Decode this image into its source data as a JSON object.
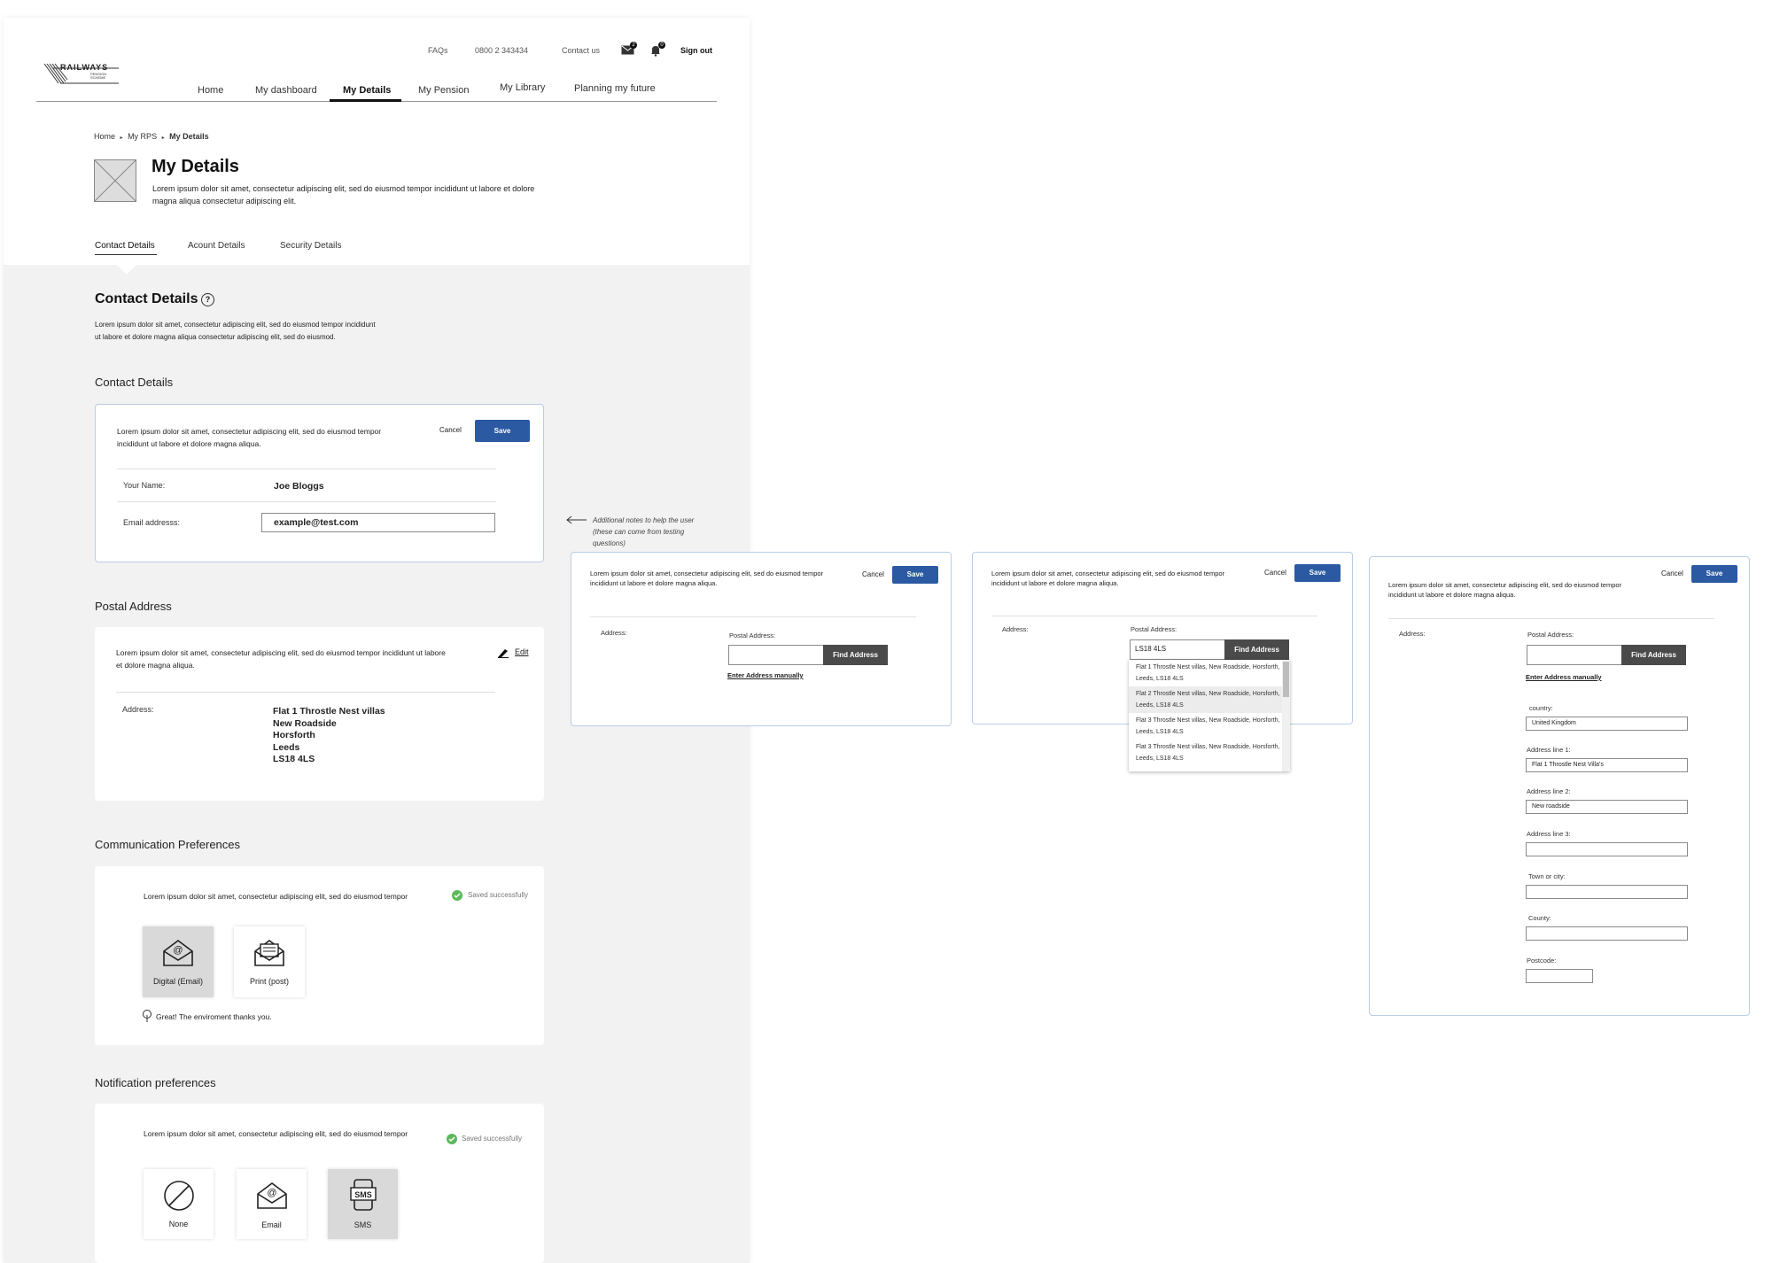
{
  "logo": {
    "name": "RAILWAYS",
    "sub": "PENSION SCHEME"
  },
  "top_links": {
    "faqs": "FAQs",
    "phone": "0800 2 343434",
    "contact": "Contact us",
    "sign_out": "Sign out",
    "mail_count": "2",
    "bell_count": "0"
  },
  "nav": {
    "items": [
      "Home",
      "My dashboard",
      "My Details",
      "My Pension",
      "My Library",
      "Planning my future"
    ]
  },
  "breadcrumb": {
    "home": "Home",
    "rps": "My RPS",
    "current": "My Details",
    "sep": "▸"
  },
  "page": {
    "title": "My Details",
    "desc_line1": "Lorem ipsum dolor sit amet, consectetur adipiscing elit, sed do eiusmod tempor incididunt ut labore et dolore",
    "desc_line2": "magna aliqua consectetur adipiscing elit."
  },
  "tabs": [
    "Contact Details",
    "Acount Details",
    "Security Details"
  ],
  "contact_section": {
    "title": "Contact Details",
    "help_icon": "?",
    "desc_line1": "Lorem ipsum dolor sit amet, consectetur adipiscing elit, sed do eiusmod tempor incididunt",
    "desc_line2": "ut labore et dolore magna aliqua consectetur adipiscing elit, sed do eiusmod."
  },
  "contact_card": {
    "heading": "Contact Details",
    "text_line1": "Lorem ipsum dolor sit amet, consectetur adipiscing elit, sed do eiusmod tempor",
    "text_line2": "incididunt ut labore et dolore magna aliqua.",
    "cancel": "Cancel",
    "save": "Save",
    "name_label": "Your Name:",
    "name_value": "Joe Bloggs",
    "email_label": "Email addresss:",
    "email_value": "example@test.com"
  },
  "annotation": {
    "line1": "Additional notes to help the user",
    "line2": "(these can come from testing",
    "line3": "questions)"
  },
  "postal": {
    "heading": "Postal Address",
    "text_line1": "Lorem ipsum dolor sit amet, consectetur adipiscing elit, sed do eiusmod tempor incididunt ut labore",
    "text_line2": "et dolore magna aliqua.",
    "edit": "Edit",
    "address_label": "Address:",
    "address_lines": [
      "Flat 1 Throstle Nest villas",
      "New Roadside",
      "Horsforth",
      "Leeds",
      "LS18 4LS"
    ]
  },
  "comm": {
    "heading": "Communication Preferences",
    "text": "Lorem ipsum dolor sit amet, consectetur adipiscing elit, sed do eiusmod tempor",
    "saved": "Saved successfully",
    "digital": "Digital (Email)",
    "print": "Print (post)",
    "env": "Great! The enviroment thanks you."
  },
  "notif": {
    "heading": "Notification preferences",
    "text": "Lorem ipsum dolor sit amet, consectetur adipiscing elit, sed do eiusmod tempor",
    "saved": "Saved successfully",
    "none": "None",
    "email": "Email",
    "sms": "SMS"
  },
  "panels": {
    "text_line1": "Lorem ipsum dolor sit amet, consectetur adipiscing elit, sed do eiusmod tempor",
    "text_line2": "incididunt ut labore et dolore magna aliqua.",
    "cancel": "Cancel",
    "save": "Save",
    "address_label": "Address:",
    "postal_label": "Postal Address:",
    "find": "Find Address",
    "manual": "Enter Address manually",
    "postcode_value": "LS18 4LS",
    "results": [
      {
        "l1": "Flat 1 Throstle Nest villas, New Roadside, Horsforth,",
        "l2": "Leeds, LS18 4LS"
      },
      {
        "l1": "Flat 2 Throstle Nest villas, New Roadside, Horsforth,",
        "l2": "Leeds, LS18 4LS"
      },
      {
        "l1": "Flat 3 Throstle Nest villas, New Roadside, Horsforth,",
        "l2": "Leeds, LS18 4LS"
      },
      {
        "l1": "Flat 3 Throstle Nest villas, New Roadside, Horsforth,",
        "l2": "Leeds, LS18 4LS"
      }
    ],
    "manual_form": {
      "country_label": "country:",
      "country_value": "United Kingdom",
      "line1_label": "Address line 1:",
      "line1_value": "Flat 1 Throstle Nest Villa's",
      "line2_label": "Address line 2:",
      "line2_value": "New roadside",
      "line3_label": "Address line 3:",
      "line3_value": "",
      "town_label": "Town or city:",
      "town_value": "",
      "county_label": "County:",
      "county_value": "",
      "postcode_label": "Postcode:",
      "postcode_value": ""
    }
  },
  "colors": {
    "primary": "#2b5aa3",
    "dark_button": "#4a4a4a",
    "success": "#5cb85c",
    "page_bg": "#f2f2f2"
  }
}
